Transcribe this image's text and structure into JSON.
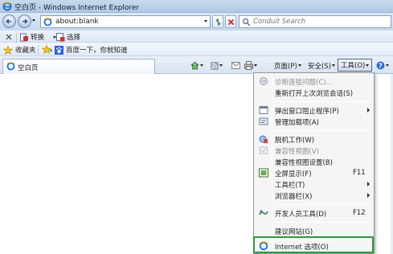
{
  "window": {
    "title": "空白页 - Windows Internet Explorer"
  },
  "address_bar": {
    "url": "about:blank"
  },
  "search": {
    "placeholder": "Conduit Search"
  },
  "toolbar": {
    "convert_label": "转换",
    "select_label": "选择"
  },
  "favorites_bar": {
    "favorites_label": "收藏夹",
    "baidu_link": "百度一下，你就知道"
  },
  "tab": {
    "label": "空白页"
  },
  "command_bar": {
    "page_label": "页面(P)",
    "safety_label": "安全(S)",
    "tools_label": "工具(O)"
  },
  "tools_menu": {
    "items": [
      {
        "label": "诊断连接问题(C)...",
        "shortcut": "",
        "icon": "diagnose-icon",
        "disabled": true,
        "submenu": false
      },
      {
        "label": "重新打开上次浏览会话(S)",
        "shortcut": "",
        "icon": "",
        "disabled": false,
        "submenu": false
      },
      {
        "label": "弹出窗口阻止程序(P)",
        "shortcut": "",
        "icon": "popup-blocker-icon",
        "disabled": false,
        "submenu": true
      },
      {
        "label": "管理加载项(A)",
        "shortcut": "",
        "icon": "addons-icon",
        "disabled": false,
        "submenu": false
      },
      {
        "label": "脱机工作(W)",
        "shortcut": "",
        "icon": "work-offline-icon",
        "disabled": false,
        "submenu": false
      },
      {
        "label": "兼容性视图(V)",
        "shortcut": "",
        "icon": "compat-view-icon",
        "disabled": true,
        "submenu": false
      },
      {
        "label": "兼容性视图设置(B)",
        "shortcut": "",
        "icon": "",
        "disabled": false,
        "submenu": false
      },
      {
        "label": "全屏显示(F)",
        "shortcut": "F11",
        "icon": "fullscreen-icon",
        "disabled": false,
        "submenu": false
      },
      {
        "label": "工具栏(T)",
        "shortcut": "",
        "icon": "",
        "disabled": false,
        "submenu": true
      },
      {
        "label": "浏览器栏(X)",
        "shortcut": "",
        "icon": "",
        "disabled": false,
        "submenu": true
      },
      {
        "label": "开发人员工具(D)",
        "shortcut": "F12",
        "icon": "developer-tools-icon",
        "disabled": false,
        "submenu": false
      },
      {
        "label": "建议网站(G)",
        "shortcut": "",
        "icon": "",
        "disabled": false,
        "submenu": false
      },
      {
        "label": "Internet 选项(O)",
        "shortcut": "",
        "icon": "internet-options-icon",
        "disabled": false,
        "submenu": false
      }
    ]
  },
  "colors": {
    "highlight_box": "#2e9a3a",
    "title_bar": "#c7d8ee"
  }
}
